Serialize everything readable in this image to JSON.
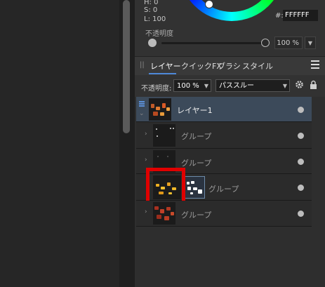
{
  "color_panel": {
    "h_label": "H: 0",
    "s_label": "S: 0",
    "l_label": "L: 100",
    "hex_label": "#:",
    "hex_value": "FFFFFF",
    "opacity_title": "不透明度",
    "opacity_value": "100 %"
  },
  "tabs": [
    {
      "label": "レイヤー",
      "active": true
    },
    {
      "label": "クイックFX",
      "active": false
    },
    {
      "label": "ブラシ",
      "active": false
    },
    {
      "label": "スタイル",
      "active": false
    }
  ],
  "layer_controls": {
    "opacity_label": "不透明度:",
    "opacity_value": "100 %",
    "blend_mode": "パススルー"
  },
  "layers": [
    {
      "name": "レイヤー1",
      "selected": true
    },
    {
      "name": "グループ",
      "selected": false
    },
    {
      "name": "グループ",
      "selected": false
    },
    {
      "name": "グループ",
      "selected": false,
      "highlighted": true
    },
    {
      "name": "グループ",
      "selected": false
    }
  ],
  "colors": {
    "accent": "#4e88d8",
    "highlight_border": "#e00000"
  }
}
